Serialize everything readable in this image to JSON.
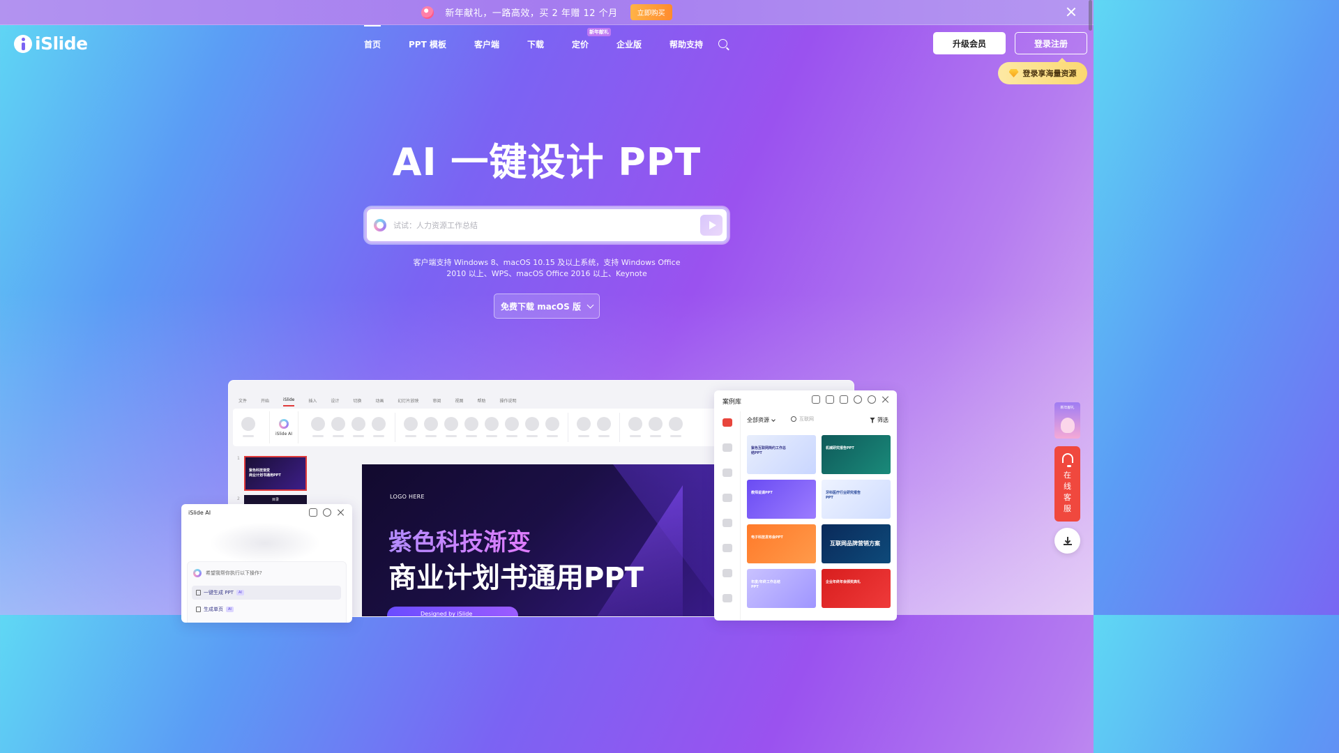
{
  "banner": {
    "text": "新年献礼，一路高效，买 2 年赠 12 个月",
    "button": "立即购买"
  },
  "logo": {
    "text": "iSlide"
  },
  "nav": {
    "items": [
      "首页",
      "PPT 模板",
      "客户端",
      "下载",
      "定价",
      "企业版",
      "帮助支持"
    ],
    "active": "首页",
    "pricing_badge": "新年献礼"
  },
  "header": {
    "upgrade": "升级会员",
    "login": "登录注册",
    "login_tip": "登录享海量资源"
  },
  "hero": {
    "title": "AI 一键设计 PPT",
    "search_placeholder": "试试：人力资源工作总结",
    "note_line1": "客户端支持 Windows 8、macOS 10.15 及以上系统，支持 Windows Office",
    "note_line2": "2010 以上、WPS、macOS Office 2016 以上、Keynote",
    "download": "免费下载 macOS 版"
  },
  "ppt_mock": {
    "tabs": [
      "文件",
      "开始",
      "iSlide",
      "插入",
      "设计",
      "切换",
      "动画",
      "幻灯片放映",
      "审阅",
      "视图",
      "帮助",
      "操作说明"
    ],
    "active_tab": "iSlide",
    "ribbon_ai_label": "iSlide AI",
    "thumb1_line1": "紫色科技渐变",
    "thumb1_line2": "商业计划书通用PPT",
    "thumb2_text": "目录",
    "slide_logo": "LOGO HERE",
    "slide_sub": "紫色科技渐变",
    "slide_main": "商业计划书通用PPT",
    "slide_pill": "Designed by iSlide"
  },
  "case_library": {
    "title": "案例库",
    "filter": "全部资源",
    "search_placeholder": "互联网",
    "screen": "筛选",
    "cards": [
      {
        "title": "紫色互联网简约工作总结PPT",
        "bg": "linear-gradient(135deg,#e8eefc,#c9d6ff)",
        "color": "#3a3a8a"
      },
      {
        "title": "机械研究报告PPT",
        "bg": "linear-gradient(135deg,#0f5a5a,#1a8a7a)",
        "color": "#ffffff"
      },
      {
        "title": "教师说课PPT",
        "bg": "linear-gradient(135deg,#6a4cf3,#9c7cff)",
        "color": "#ffffff"
      },
      {
        "title": "牙科医疗行业研究报告PPT",
        "bg": "linear-gradient(135deg,#eef3ff,#cfdcff)",
        "color": "#2a4a9a"
      },
      {
        "title": "电子科技发布会PPT",
        "bg": "linear-gradient(135deg,#ff7a2a,#ff9a4a)",
        "color": "#ffffff"
      },
      {
        "title": "互联网品牌营销方案",
        "bg": "linear-gradient(135deg,#0a2a5a,#0e4a7a)",
        "color": "#ffffff",
        "big": true
      },
      {
        "title": "年度/年终工作总结PPT",
        "bg": "linear-gradient(135deg,#c9c2ff,#9f95ff)",
        "color": "#ffffff"
      },
      {
        "title": "企业年终年会颁奖典礼",
        "bg": "linear-gradient(135deg,#d81e1e,#ef3a3a)",
        "color": "#ffffff"
      }
    ]
  },
  "ai_panel": {
    "title": "iSlide AI",
    "question": "希望我帮你执行以下操作?",
    "options": [
      "一键生成 PPT",
      "生成单页"
    ],
    "tag": "AI"
  },
  "right_widgets": {
    "promo_label": "新年献礼",
    "service": "在线客服"
  }
}
